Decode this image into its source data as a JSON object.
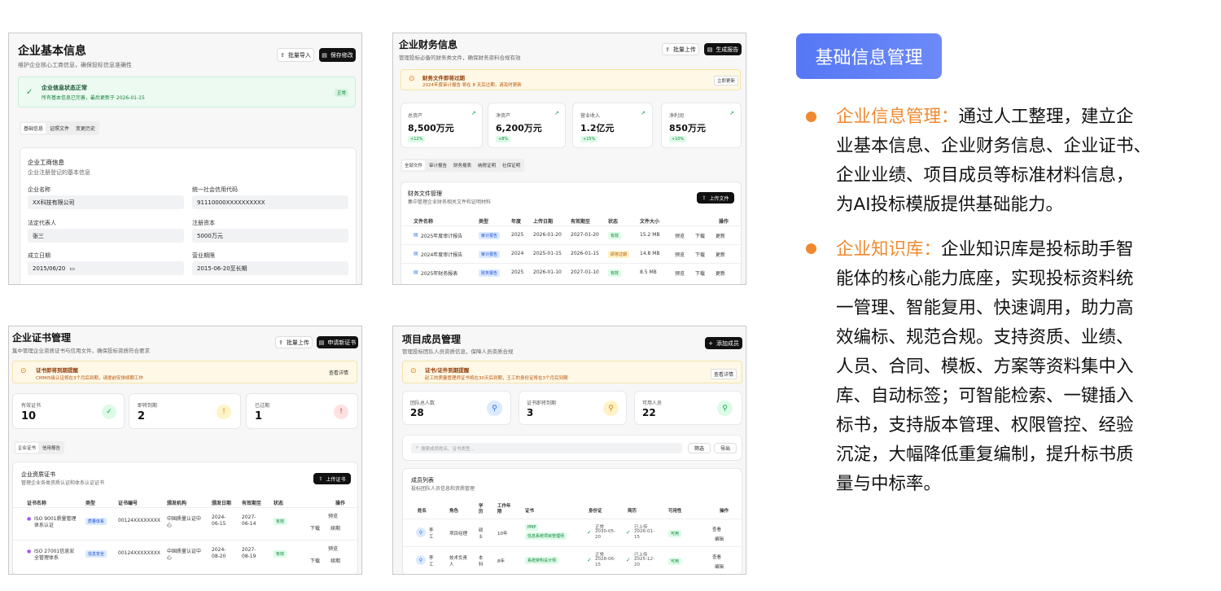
{
  "p1": {
    "title": "企业基本信息",
    "sub": "维护企业核心工商信息，确保投标信息准确性",
    "btn_import": "批量导入",
    "btn_save": "保存修改",
    "alert_title": "企业信息状态正常",
    "alert_text": "所有基本信息已完善，最后更新于 2026-01-15",
    "alert_badge": "正常",
    "tabs": [
      "基础信息",
      "证照文件",
      "变更历史"
    ],
    "card_title": "企业工商信息",
    "card_sub": "企业注册登记的基本信息",
    "f_name_l": "企业名称",
    "f_name_v": "XX科技有限公司",
    "f_code_l": "统一社会信用代码",
    "f_code_v": "91110000XXXXXXXXXX",
    "f_rep_l": "法定代表人",
    "f_rep_v": "张三",
    "f_cap_l": "注册资本",
    "f_cap_v": "5000万元",
    "f_date_l": "成立日期",
    "f_date_v": "2015/06/20",
    "f_term_l": "营业期限",
    "f_term_v": "2015-06-20至长期"
  },
  "p2": {
    "title": "企业财务信息",
    "sub": "管理投标必备的财务类文件，确保财务资料合规有效",
    "btn_upload": "批量上传",
    "btn_report": "生成报告",
    "alert_title": "财务文件即将过期",
    "alert_text": "2024年度审计报告 将在 8 天后过期，请及时更新",
    "alert_btn": "立即更新",
    "stats": [
      {
        "label": "总资产",
        "value": "8,500万元",
        "delta": "+12%"
      },
      {
        "label": "净资产",
        "value": "6,200万元",
        "delta": "+8%"
      },
      {
        "label": "营业收入",
        "value": "1.2亿元",
        "delta": "+15%"
      },
      {
        "label": "净利润",
        "value": "850万元",
        "delta": "+10%"
      }
    ],
    "tabs": [
      "全部文件",
      "审计报告",
      "财务报表",
      "纳税证明",
      "社保证明"
    ],
    "card_title": "财务文件管理",
    "card_sub": "集中管理企业财务相关文件和证明材料",
    "btn_upload_file": "上传文件",
    "headers": [
      "文件名称",
      "类型",
      "年度",
      "上传日期",
      "有效期至",
      "状态",
      "文件大小",
      "操作"
    ],
    "rows": [
      {
        "name": "2025年度审计报告",
        "type": "审计报告",
        "year": "2025",
        "up": "2026-01-20",
        "exp": "2027-01-20",
        "status": "有效",
        "size": "15.2 MB",
        "a1": "预览",
        "a2": "下载",
        "a3": "更新"
      },
      {
        "name": "2024年度审计报告",
        "type": "审计报告",
        "year": "2024",
        "up": "2025-01-15",
        "exp": "2026-01-15",
        "status": "即将过期",
        "size": "14.8 MB",
        "a1": "预览",
        "a2": "下载",
        "a3": "更新"
      },
      {
        "name": "2025年财务报表",
        "type": "财务报告",
        "year": "2025",
        "up": "2026-01-10",
        "exp": "2027-01-10",
        "status": "有效",
        "size": "8.5 MB",
        "a1": "预览",
        "a2": "下载",
        "a3": "更新"
      }
    ]
  },
  "p3": {
    "title": "企业证书管理",
    "sub": "集中管理企业资质证书与信用文件，确保投标资质符合要求",
    "btn_upload": "批量上传",
    "btn_apply": "申请新证书",
    "alert_title": "证书即将到期提醒",
    "alert_text": "CMMI5级认证将在3个月后到期，请提前安排续期工作",
    "alert_btn": "查看详情",
    "stats": [
      {
        "label": "有效证书",
        "value": "10"
      },
      {
        "label": "即将到期",
        "value": "2"
      },
      {
        "label": "已过期",
        "value": "1"
      }
    ],
    "tabs": [
      "企业证书",
      "信用报告"
    ],
    "card_title": "企业资质证书",
    "card_sub": "管理企业各类资质认证和体系认证证书",
    "btn_upload_cert": "上传证书",
    "headers": [
      "证书名称",
      "类型",
      "证书编号",
      "颁发机构",
      "颁发日期",
      "有效期至",
      "状态",
      "操作"
    ],
    "rows": [
      {
        "name1": "ISO 9001质量管理",
        "name2": "体系认证",
        "type": "质量体系",
        "no": "00124XXXXXXXX",
        "org1": "中国质量认证中",
        "org2": "心",
        "d1a": "2024-",
        "d1b": "06-15",
        "d2a": "2027-",
        "d2b": "06-14",
        "status": "有效",
        "a1": "预览",
        "a2": "下载",
        "a3": "续期"
      },
      {
        "name1": "ISO 27001信息安",
        "name2": "全管理体系",
        "type": "信息安全",
        "no": "00124XXXXXXXX",
        "org1": "中国质量认证中",
        "org2": "心",
        "d1a": "2024-",
        "d1b": "08-20",
        "d2a": "2027-",
        "d2b": "08-19",
        "status": "有效",
        "a1": "预览",
        "a2": "下载",
        "a3": "续期"
      }
    ]
  },
  "p4": {
    "title": "项目成员管理",
    "sub": "管理投标团队人员资质信息，保障人员资质合规",
    "btn_add": "添加成员",
    "alert_title": "证书/证件到期提醒",
    "alert_text": "赵工的质量管理师证书将在30天后到期，王工的身份证将在3个月后到期",
    "alert_btn": "查看详情",
    "stats": [
      {
        "label": "团队总人数",
        "value": "28"
      },
      {
        "label": "证书即将到期",
        "value": "3"
      },
      {
        "label": "可用人员",
        "value": "22"
      }
    ],
    "search_ph": "搜索成员姓名、证书类型...",
    "btn_filter": "筛选",
    "btn_export": "导出",
    "card_title": "成员列表",
    "card_sub": "投标团队人员信息和资质管理",
    "headers": [
      "姓名",
      "角色",
      "学历",
      "工作年限",
      "证书",
      "身份证",
      "简历",
      "可用性",
      "操作"
    ],
    "rows": [
      {
        "n1": "李",
        "n2": "工",
        "role": "项目经理",
        "edu1": "硕",
        "edu2": "士",
        "yrs": "10年",
        "cert1": "PMP",
        "cert2": "信息系统项目管理师",
        "id1": "正常",
        "id2": "2030-05-",
        "id3": "20",
        "cv1": "已上传",
        "cv2": "2026-01-",
        "cv3": "15",
        "avail": "可用",
        "a1": "查看",
        "a2": "编辑"
      },
      {
        "n1": "李",
        "n2": "工",
        "role1": "技术负责",
        "role2": "人",
        "edu1": "本",
        "edu2": "科",
        "yrs": "8年",
        "cert1": "系统架构设计师",
        "id1": "正常",
        "id2": "2028-06-",
        "id3": "15",
        "cv1": "已上传",
        "cv2": "2025-12-",
        "cv3": "20",
        "avail": "可用",
        "a1": "查看",
        "a2": "编辑"
      }
    ]
  },
  "right": {
    "title": "基础信息管理",
    "item1_hl": "企业信息管理：",
    "item1_lines": [
      "通过人工整理，建立企",
      "业基本信息、企业财务信息、企业证书、",
      "企业业绩、项目成员等标准材料信息，",
      "为AI投标模版提供基础能力。"
    ],
    "item2_hl": "企业知识库：",
    "item2_lines": [
      "企业知识库是投标助手智",
      "能体的核心能力底座，实现投标资料统",
      "一管理、智能复用、快速调用，助力高",
      "效编标、规范合规。支持资质、业绩、",
      "人员、合同、模板、方案等资料集中入",
      "库、自动标签；可智能检索、一键插入",
      "标书，支持版本管理、权限管控、经验",
      "沉淀，大幅降低重复编制，提升标书质",
      "量与中标率。"
    ]
  },
  "colors": {
    "accent": "#f0892e",
    "title_bg": "#5f7ef7",
    "green": "#16a34a",
    "amber": "#f59e0b",
    "red": "#ef4444",
    "blue": "#3b82f6"
  }
}
